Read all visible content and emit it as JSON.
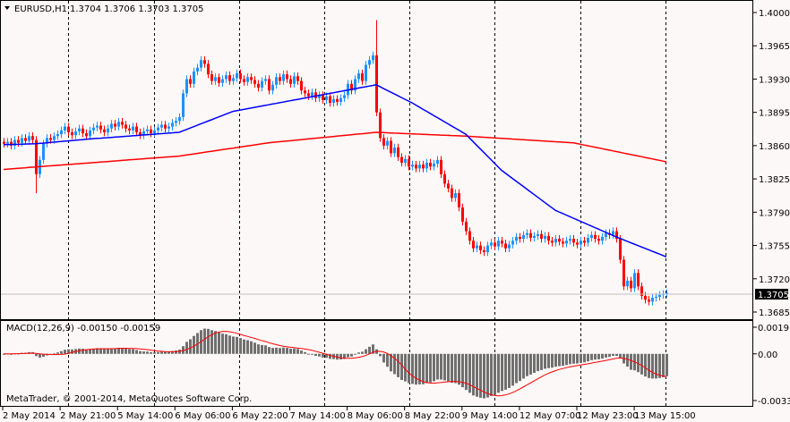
{
  "header": {
    "symbol": "EURUSD,H1",
    "ohlc": "1.3704 1.3706 1.3703 1.3705"
  },
  "macd_header": {
    "label": "MACD(12,26,9)",
    "values": "-0.00150 -0.00159"
  },
  "copyright": "MetaTrader, © 2001-2014, MetaQuotes Software Corp.",
  "colors": {
    "bull": "#1e90ff",
    "bear": "#ff0000",
    "ma_fast": "#0000ff",
    "ma_slow": "#ff0000",
    "hist": "#707070",
    "signal": "#ff0000",
    "bg": "#fcf8f7"
  },
  "chart_data": {
    "type": "candlestick",
    "title": "EURUSD,H1",
    "price_ticks": [
      "1.4000",
      "1.3965",
      "1.3930",
      "1.3895",
      "1.3860",
      "1.3825",
      "1.3790",
      "1.3755",
      "1.3720",
      "1.3685"
    ],
    "current_price": "1.3705",
    "ylim": [
      1.3685,
      1.4
    ],
    "time_labels": [
      "2 May 2014",
      "2 May 21:00",
      "5 May 14:00",
      "6 May 06:00",
      "6 May 22:00",
      "7 May 14:00",
      "8 May 06:00",
      "8 May 22:00",
      "9 May 14:00",
      "12 May 07:00",
      "12 May 23:00",
      "13 May 15:00"
    ],
    "closes": [
      1.3862,
      1.3864,
      1.386,
      1.3866,
      1.3863,
      1.3868,
      1.3865,
      1.387,
      1.3866,
      1.383,
      1.3845,
      1.3862,
      1.3868,
      1.3866,
      1.387,
      1.3872,
      1.3876,
      1.388,
      1.3874,
      1.3871,
      1.3875,
      1.3878,
      1.3873,
      1.387,
      1.3876,
      1.3879,
      1.3881,
      1.3877,
      1.3874,
      1.3878,
      1.3883,
      1.388,
      1.3885,
      1.3882,
      1.3878,
      1.3876,
      1.388,
      1.3874,
      1.3871,
      1.3875,
      1.3877,
      1.3873,
      1.3876,
      1.3879,
      1.3882,
      1.3878,
      1.388,
      1.3884,
      1.3886,
      1.389,
      1.3915,
      1.393,
      1.3925,
      1.3938,
      1.3942,
      1.395,
      1.3946,
      1.3935,
      1.3928,
      1.3932,
      1.3926,
      1.393,
      1.3934,
      1.3928,
      1.3931,
      1.3936,
      1.393,
      1.3927,
      1.3932,
      1.3929,
      1.3925,
      1.3921,
      1.3928,
      1.393,
      1.3918,
      1.3924,
      1.3932,
      1.3928,
      1.3935,
      1.393,
      1.3925,
      1.3933,
      1.3928,
      1.3918,
      1.3915,
      1.3912,
      1.3916,
      1.391,
      1.3913,
      1.3908,
      1.3912,
      1.3905,
      1.3909,
      1.3906,
      1.391,
      1.3913,
      1.3925,
      1.3918,
      1.393,
      1.3936,
      1.3928,
      1.3945,
      1.395,
      1.3955,
      1.3895,
      1.3868,
      1.386,
      1.3865,
      1.3852,
      1.3858,
      1.3848,
      1.3842,
      1.3846,
      1.3838,
      1.384,
      1.3836,
      1.384,
      1.3836,
      1.3842,
      1.3838,
      1.3841,
      1.3845,
      1.383,
      1.382,
      1.3815,
      1.3805,
      1.381,
      1.3795,
      1.378,
      1.377,
      1.376,
      1.3752,
      1.3755,
      1.375,
      1.3748,
      1.3755,
      1.3758,
      1.3754,
      1.376,
      1.3757,
      1.3752,
      1.3756,
      1.376,
      1.3764,
      1.3762,
      1.3766,
      1.3768,
      1.3763,
      1.3765,
      1.3767,
      1.3762,
      1.3765,
      1.376,
      1.3758,
      1.3762,
      1.3759,
      1.3757,
      1.376,
      1.3762,
      1.3758,
      1.3756,
      1.376,
      1.3758,
      1.3763,
      1.3766,
      1.3762,
      1.376,
      1.3764,
      1.3768,
      1.3766,
      1.377,
      1.3762,
      1.374,
      1.3712,
      1.3718,
      1.371,
      1.3726,
      1.3712,
      1.3702,
      1.3698,
      1.3696,
      1.37,
      1.3701,
      1.3703,
      1.3704,
      1.3705
    ],
    "spikes": {
      "9": {
        "low": 1.381
      },
      "104": {
        "high": 1.3992,
        "open": 1.3955
      }
    },
    "ma_fast": [
      [
        0,
        1.3861
      ],
      [
        9,
        1.3862
      ],
      [
        24,
        1.3867
      ],
      [
        49,
        1.3874
      ],
      [
        64,
        1.3896
      ],
      [
        84,
        1.391
      ],
      [
        104,
        1.3924
      ],
      [
        114,
        1.3905
      ],
      [
        129,
        1.3872
      ],
      [
        139,
        1.3834
      ],
      [
        154,
        1.3792
      ],
      [
        171,
        1.3764
      ],
      [
        185,
        1.3743
      ]
    ],
    "ma_slow": [
      [
        0,
        1.3835
      ],
      [
        49,
        1.3849
      ],
      [
        74,
        1.3863
      ],
      [
        104,
        1.3874
      ],
      [
        129,
        1.387
      ],
      [
        159,
        1.3863
      ],
      [
        185,
        1.3843
      ]
    ],
    "macd": {
      "fast": 12,
      "slow": 26,
      "signal": 9,
      "ticks": [
        "0.00191",
        "0.00",
        "-0.00335"
      ],
      "ylim": [
        -0.00335,
        0.00191
      ]
    }
  }
}
